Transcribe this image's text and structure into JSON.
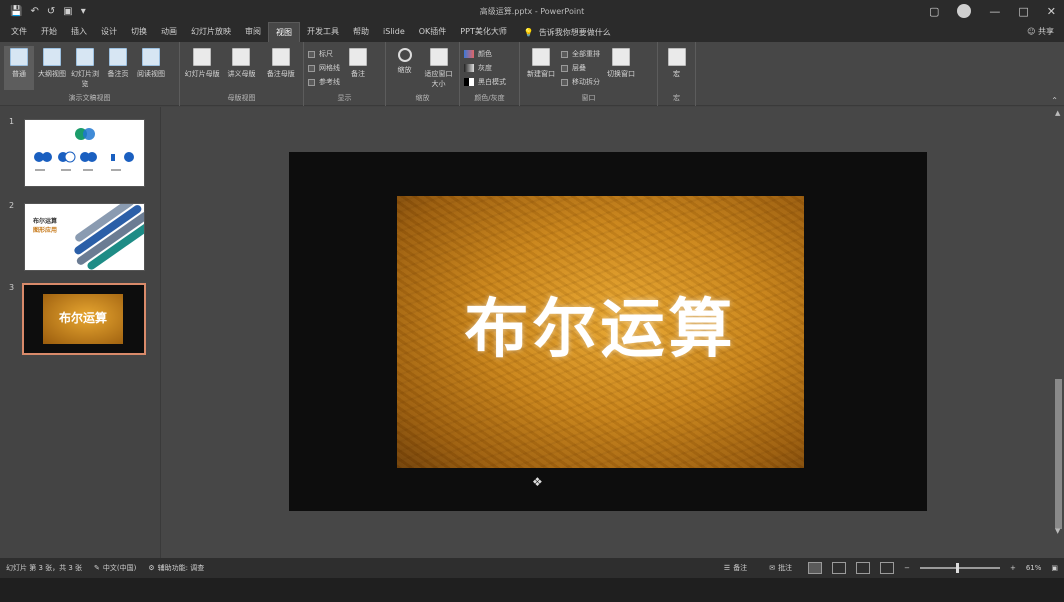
{
  "titlebar": {
    "doc_title": "高级运算.pptx - PowerPoint",
    "qat": [
      "save-icon",
      "undo-icon",
      "redo-icon",
      "present-icon",
      "more-icon"
    ],
    "controls": [
      "ribbon-display-icon",
      "minimize-icon",
      "maximize-icon",
      "close-icon"
    ]
  },
  "tabs": [
    "文件",
    "开始",
    "插入",
    "设计",
    "切换",
    "动画",
    "幻灯片放映",
    "审阅",
    "视图",
    "开发工具",
    "帮助",
    "iSlide",
    "OK插件",
    "PPT美化大师"
  ],
  "active_tab": "视图",
  "tell_me": "告诉我你想要做什么",
  "share_label": "共享",
  "ribbon": {
    "groups": [
      {
        "label": "演示文稿视图",
        "buttons": [
          "普通",
          "大纲视图",
          "幻灯片浏览",
          "备注页",
          "阅读视图"
        ]
      },
      {
        "label": "母版视图",
        "buttons": [
          "幻灯片母版",
          "讲义母版",
          "备注母版"
        ]
      },
      {
        "label": "显示",
        "checks": [
          "标尺",
          "网格线",
          "参考线"
        ],
        "button": "备注"
      },
      {
        "label": "缩放",
        "buttons": [
          "缩放",
          "适应窗口大小"
        ]
      },
      {
        "label": "颜色/灰度",
        "options": [
          "颜色",
          "灰度",
          "黑白模式"
        ]
      },
      {
        "label": "窗口",
        "buttons": [
          "新建窗口",
          "全部重排",
          "层叠",
          "移动拆分",
          "切换窗口"
        ]
      },
      {
        "label": "宏",
        "buttons": [
          "宏"
        ]
      }
    ]
  },
  "thumbnails": [
    "1",
    "2",
    "3"
  ],
  "slide": {
    "title": "布尔运算"
  },
  "thumb2_text": [
    "布尔运算",
    "图形应用"
  ],
  "thumb3_text": "布尔运算",
  "status": {
    "slide_info": "幻灯片 第 3 张，共 3 张",
    "language": "中文(中国)",
    "accessibility": "辅助功能: 调查",
    "notes": "备注",
    "comments": "批注",
    "zoom": "61%"
  },
  "colors": {
    "accent": "#d98a6a",
    "ribbon": "#474747",
    "titlebar": "#2b2b2b"
  }
}
